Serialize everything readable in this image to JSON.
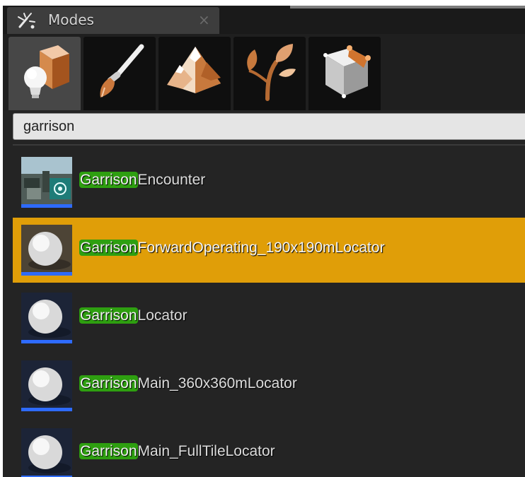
{
  "panel": {
    "title": "Modes",
    "title_icon": "modes-wand-icon",
    "close_glyph": "×"
  },
  "toolbar": {
    "modes": [
      {
        "name": "place",
        "icon": "place-mode-icon",
        "active": true
      },
      {
        "name": "paint",
        "icon": "paint-brush-icon",
        "active": false
      },
      {
        "name": "landscape",
        "icon": "mountain-icon",
        "active": false
      },
      {
        "name": "foliage",
        "icon": "foliage-leaf-icon",
        "active": false
      },
      {
        "name": "geometry",
        "icon": "geometry-cube-icon",
        "active": false
      }
    ]
  },
  "search": {
    "value": "garrison"
  },
  "results": [
    {
      "match": "Garrison",
      "rest": "Encounter",
      "thumb": "encounter-thumbnail",
      "selected": false
    },
    {
      "match": "Garrison",
      "rest": "ForwardOperating_190x190mLocator",
      "thumb": "sphere-thumbnail",
      "selected": true
    },
    {
      "match": "Garrison",
      "rest": "Locator",
      "thumb": "sphere-thumbnail",
      "selected": false
    },
    {
      "match": "Garrison",
      "rest": "Main_360x360mLocator",
      "thumb": "sphere-thumbnail",
      "selected": false
    },
    {
      "match": "Garrison",
      "rest": "Main_FullTileLocator",
      "thumb": "sphere-thumbnail",
      "selected": false
    }
  ],
  "colors": {
    "panel_bg": "#242424",
    "selected_row": "#e09e08",
    "match_highlight": "#2e9f10",
    "thumb_accent": "#2e6bff"
  }
}
